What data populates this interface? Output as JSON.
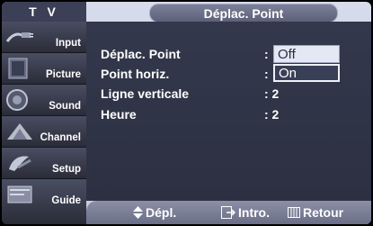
{
  "header": {
    "tv_label": "T V",
    "title": "Déplac. Point"
  },
  "sidebar": {
    "items": [
      {
        "label": "Input",
        "icon": "input-icon"
      },
      {
        "label": "Picture",
        "icon": "picture-icon"
      },
      {
        "label": "Sound",
        "icon": "sound-icon"
      },
      {
        "label": "Channel",
        "icon": "channel-icon"
      },
      {
        "label": "Setup",
        "icon": "setup-icon"
      },
      {
        "label": "Guide",
        "icon": "guide-icon"
      }
    ]
  },
  "menu": {
    "rows": [
      {
        "label": "Déplac. Point",
        "value": ":"
      },
      {
        "label": "Point horiz.",
        "value": ":"
      },
      {
        "label": "Ligne verticale",
        "value": ": 2"
      },
      {
        "label": "Heure",
        "value": ": 2"
      }
    ],
    "dropdown": {
      "options": [
        "Off",
        "On"
      ],
      "selected": "On"
    }
  },
  "footer": {
    "move_label": "Dépl.",
    "enter_label": "Intro.",
    "return_label": "Retour"
  },
  "colors": {
    "panel": "#33384c",
    "highlight": "#eef0f8"
  }
}
